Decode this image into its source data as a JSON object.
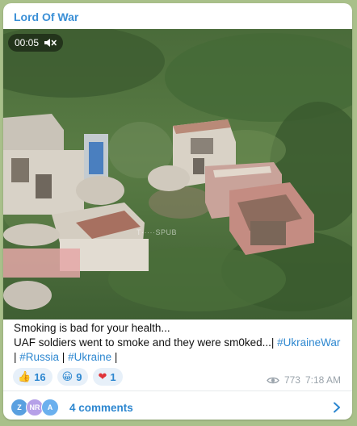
{
  "channel": {
    "name": "Lord Of War",
    "name_color": "#3a8fd6"
  },
  "video": {
    "duration": "00:05",
    "muted_icon": "speaker-muted-icon",
    "watermark": "T·····SPUB"
  },
  "caption": {
    "line1": "Smoking is bad for your health...",
    "line2": "UAF soldiers went to smoke and they were sm0ked...| ",
    "hashtags": [
      "#UkraineWar",
      "#Russia",
      "#Ukraine"
    ],
    "separator": " | ",
    "trailing": " |"
  },
  "reactions": [
    {
      "emoji": "👍",
      "icon": "thumbs-up-icon",
      "count": "16"
    },
    {
      "emoji": "😀",
      "icon": "grinning-face-icon",
      "count": "9"
    },
    {
      "emoji": "❤",
      "icon": "red-heart-icon",
      "count": "1"
    }
  ],
  "meta": {
    "views": "773",
    "time": "7:18 AM",
    "views_icon": "eye-icon"
  },
  "comments": {
    "label": "4 comments",
    "avatars": [
      {
        "initials": "Z",
        "color": "#5aa0e0"
      },
      {
        "initials": "NR",
        "color": "#b6a0e8"
      },
      {
        "initials": "A",
        "color": "#6bb0ee"
      }
    ],
    "chevron_icon": "chevron-right-icon"
  },
  "colors": {
    "accent": "#2d87d0",
    "reaction_bg": "#e7f0f9",
    "page_bg": "#a9c08a",
    "meta_text": "#9aa3ab"
  }
}
